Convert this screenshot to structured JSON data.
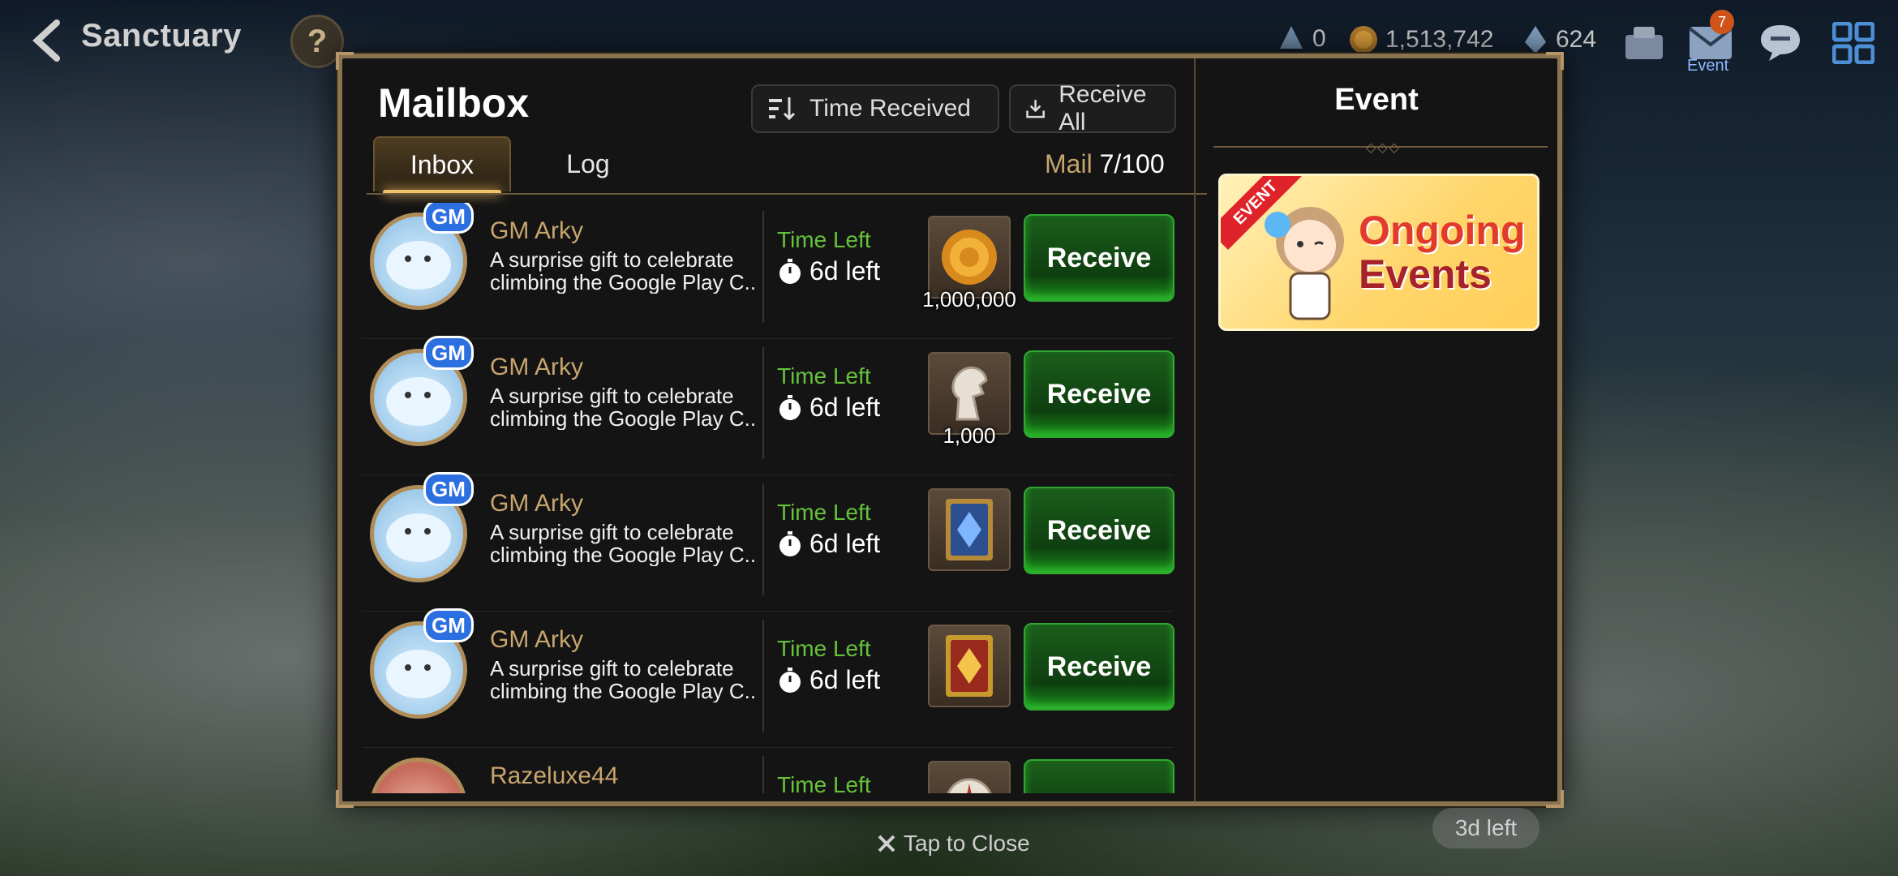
{
  "topbar": {
    "title": "Sanctuary",
    "help_label": "?",
    "currencies": [
      {
        "icon": "crystal-icon",
        "value": "0"
      },
      {
        "icon": "gold-coin-icon",
        "value": "1,513,742"
      },
      {
        "icon": "stamina-icon",
        "value": "624"
      }
    ],
    "mail_badge": "7",
    "event_caption": "Event"
  },
  "mailbox": {
    "title": "Mailbox",
    "sort_label": "Time Received",
    "receive_all_label": "Receive All",
    "tabs": [
      {
        "label": "Inbox",
        "active": true
      },
      {
        "label": "Log",
        "active": false
      }
    ],
    "mail_count_label": "Mail",
    "mail_count_value": "7/100",
    "items": [
      {
        "sender": "GM Arky",
        "message_line1": "A surprise gift to celebrate",
        "message_line2": "climbing the Google Play C...",
        "time_label": "Time Left",
        "time_value": "6d left",
        "reward_icon": "gold-coin-icon",
        "reward_qty": "1,000,000",
        "receive_label": "Receive"
      },
      {
        "sender": "GM Arky",
        "message_line1": "A surprise gift to celebrate",
        "message_line2": "climbing the Google Play C...",
        "time_label": "Time Left",
        "time_value": "6d left",
        "reward_icon": "horse-head-icon",
        "reward_qty": "1,000",
        "receive_label": "Receive"
      },
      {
        "sender": "GM Arky",
        "message_line1": "A surprise gift to celebrate",
        "message_line2": "climbing the Google Play C...",
        "time_label": "Time Left",
        "time_value": "6d left",
        "reward_icon": "blue-card-icon",
        "reward_qty": "",
        "receive_label": "Receive"
      },
      {
        "sender": "GM Arky",
        "message_line1": "A surprise gift to celebrate",
        "message_line2": "climbing the Google Play C...",
        "time_label": "Time Left",
        "time_value": "6d left",
        "reward_icon": "gold-card-icon",
        "reward_qty": "",
        "receive_label": "Receive"
      },
      {
        "sender": "Razeluxe44",
        "message_line1": "",
        "message_line2": "",
        "time_label": "Time Left",
        "time_value": "",
        "reward_icon": "compass-icon",
        "reward_qty": "",
        "receive_label": ""
      }
    ],
    "gm_badge": "GM"
  },
  "event_panel": {
    "title": "Event",
    "ribbon": "EVENT",
    "banner_line1": "Ongoing",
    "banner_line2": "Events"
  },
  "footer": {
    "tap_close": "Tap to Close",
    "bg_pill": "3d left"
  }
}
